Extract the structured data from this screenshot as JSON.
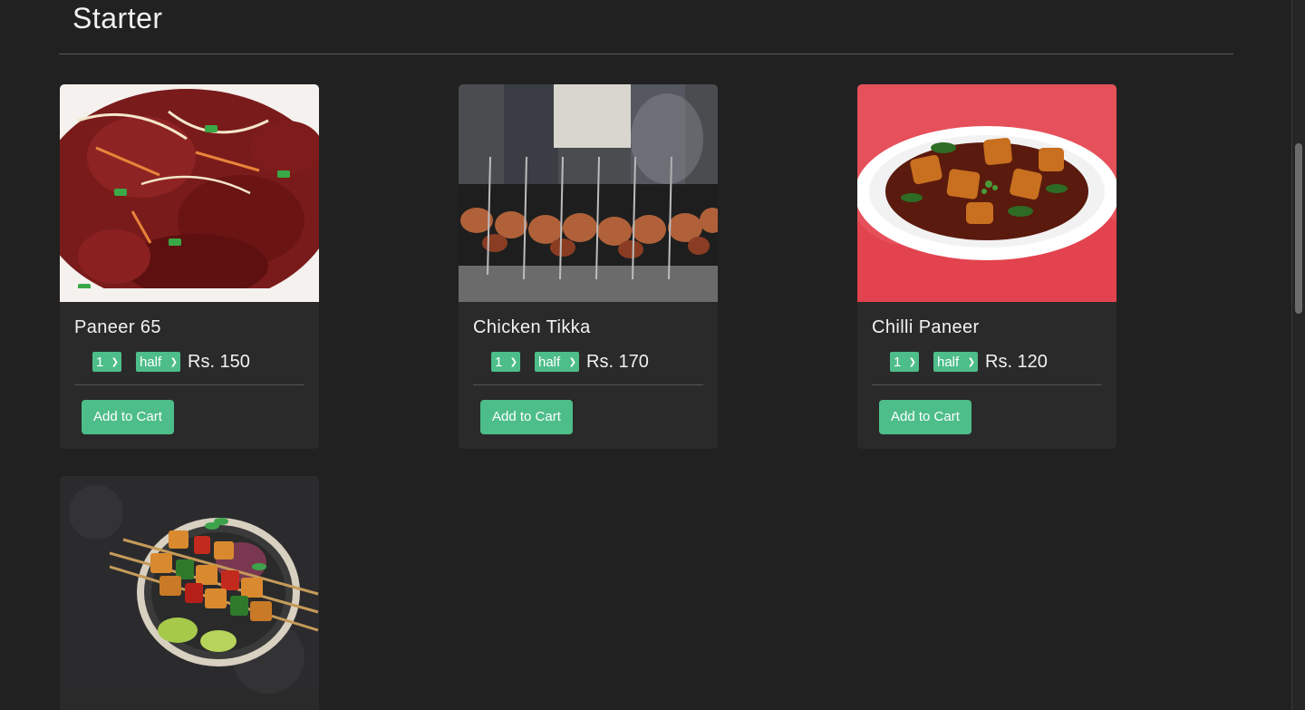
{
  "section": {
    "title": "Starter"
  },
  "cards": [
    {
      "name": "Paneer 65",
      "qty": "1",
      "portion": "half",
      "price": "Rs. 150",
      "button": "Add to Cart",
      "image": "paneer-65-photo"
    },
    {
      "name": "Chicken Tikka",
      "qty": "1",
      "portion": "half",
      "price": "Rs. 170",
      "button": "Add to Cart",
      "image": "chicken-tikka-photo"
    },
    {
      "name": "Chilli Paneer",
      "qty": "1",
      "portion": "half",
      "price": "Rs. 120",
      "button": "Add to Cart",
      "image": "chilli-paneer-photo"
    },
    {
      "image": "paneer-tikka-skewers-photo"
    }
  ],
  "colors": {
    "background": "#212121",
    "card": "#2a2a2a",
    "accent": "#4dbd8a"
  }
}
